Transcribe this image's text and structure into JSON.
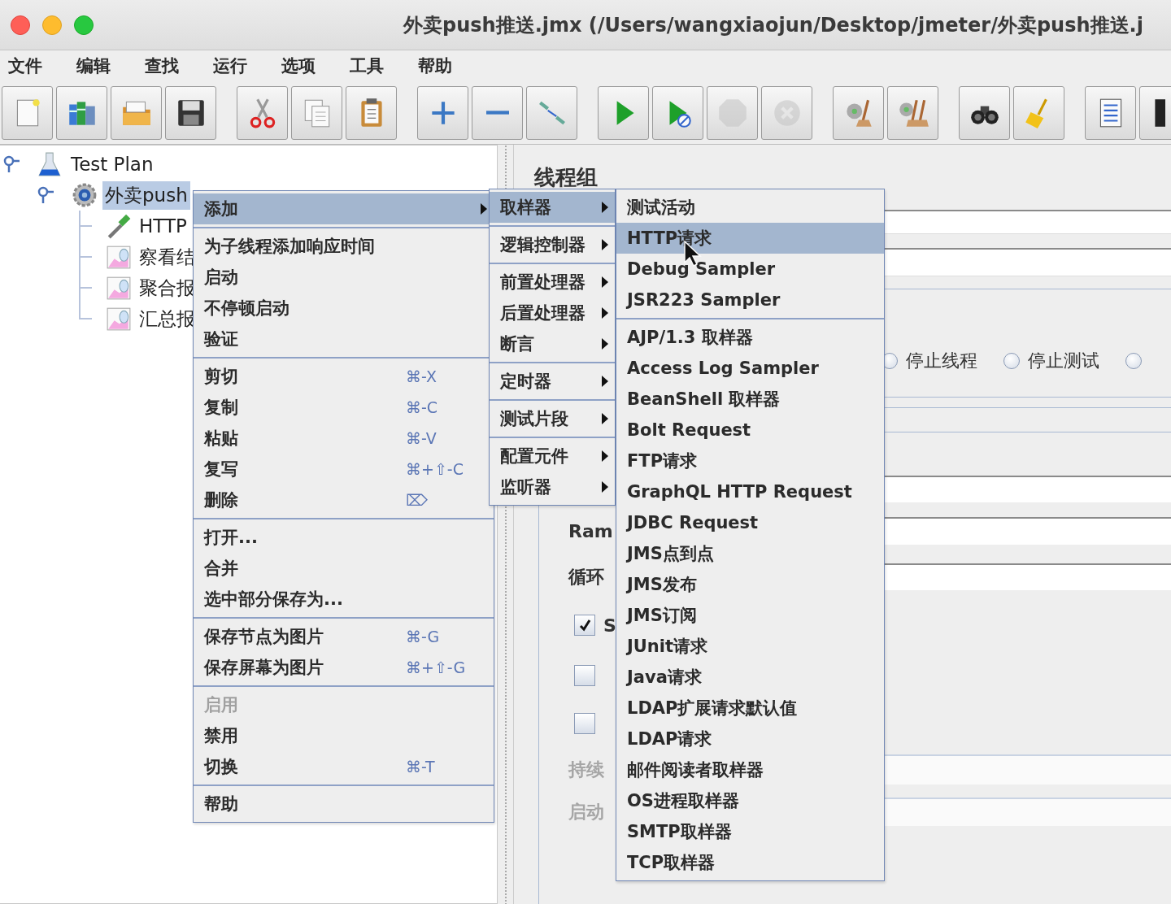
{
  "window": {
    "title": "外卖push推送.jmx (/Users/wangxiaojun/Desktop/jmeter/外卖push推送.j"
  },
  "menu_bar": [
    "文件",
    "编辑",
    "查找",
    "运行",
    "选项",
    "工具",
    "帮助"
  ],
  "toolbar": {
    "groups": [
      [
        {
          "kind": "new",
          "disabled": false
        },
        {
          "kind": "templates",
          "disabled": false
        },
        {
          "kind": "open",
          "disabled": false
        },
        {
          "kind": "save",
          "disabled": false
        }
      ],
      [
        {
          "kind": "cut",
          "disabled": false
        },
        {
          "kind": "copy",
          "disabled": false
        },
        {
          "kind": "paste",
          "disabled": false
        }
      ],
      [
        {
          "kind": "expand",
          "disabled": false
        },
        {
          "kind": "collapse",
          "disabled": false
        },
        {
          "kind": "toggle",
          "disabled": false
        }
      ],
      [
        {
          "kind": "start",
          "disabled": false
        },
        {
          "kind": "start_no_pauses",
          "disabled": false
        },
        {
          "kind": "stop",
          "disabled": true
        },
        {
          "kind": "shutdown",
          "disabled": true
        }
      ],
      [
        {
          "kind": "clear",
          "disabled": false
        },
        {
          "kind": "clear_all",
          "disabled": false
        }
      ],
      [
        {
          "kind": "search",
          "disabled": false
        },
        {
          "kind": "reset_search",
          "disabled": false
        }
      ],
      [
        {
          "kind": "function_helper",
          "disabled": false
        },
        {
          "kind": "help",
          "disabled": false
        }
      ]
    ]
  },
  "tree": [
    {
      "label": "Test Plan",
      "kind": "plan",
      "selected": false,
      "children": [
        {
          "label": "外卖push",
          "kind": "thread_group",
          "selected": true,
          "children": [
            {
              "label": "HTTP",
              "kind": "sampler",
              "selected": false
            },
            {
              "label": "察看结",
              "kind": "listener",
              "selected": false
            },
            {
              "label": "聚合报",
              "kind": "listener",
              "selected": false
            },
            {
              "label": "汇总报",
              "kind": "listener",
              "selected": false
            }
          ]
        }
      ]
    }
  ],
  "editor": {
    "title": "线程组",
    "top_fields": [
      {
        "kind": "field",
        "disabled": false
      },
      {
        "kind": "field",
        "disabled": false
      }
    ],
    "on_error_options": [
      {
        "label": "停止线程",
        "selected": false
      },
      {
        "label": "停止测试",
        "selected": false
      },
      {
        "selected": false
      }
    ],
    "thread_properties": [
      {
        "kind": "field",
        "disabled": false
      },
      {
        "kind": "field",
        "label": "Ram",
        "disabled": false
      },
      {
        "kind": "field",
        "label": "循环",
        "disabled": false
      },
      {
        "kind": "checkbox",
        "label": "S",
        "checked": true
      },
      {
        "kind": "checkbox",
        "checked": false
      },
      {
        "kind": "checkbox",
        "checked": false
      },
      {
        "kind": "field",
        "label": "持续",
        "disabled": true
      },
      {
        "kind": "field",
        "label": "启动",
        "disabled": true
      }
    ]
  },
  "context_menu": {
    "sections": [
      [
        {
          "label": "添加",
          "selected": true,
          "submenu": true,
          "disabled": false
        }
      ],
      [
        {
          "label": "为子线程添加响应时间",
          "selected": false,
          "submenu": false,
          "disabled": false
        },
        {
          "label": "启动",
          "selected": false,
          "submenu": false,
          "disabled": false
        },
        {
          "label": "不停顿启动",
          "selected": false,
          "submenu": false,
          "disabled": false
        },
        {
          "label": "验证",
          "selected": false,
          "submenu": false,
          "disabled": false
        }
      ],
      [
        {
          "label": "剪切",
          "shortcut": "⌘-X",
          "selected": false,
          "submenu": false,
          "disabled": false
        },
        {
          "label": "复制",
          "shortcut": "⌘-C",
          "selected": false,
          "submenu": false,
          "disabled": false
        },
        {
          "label": "粘贴",
          "shortcut": "⌘-V",
          "selected": false,
          "submenu": false,
          "disabled": false
        },
        {
          "label": "复写",
          "shortcut": "⌘+⇧-C",
          "selected": false,
          "submenu": false,
          "disabled": false
        },
        {
          "label": "删除",
          "shortcut": "⌦",
          "selected": false,
          "submenu": false,
          "disabled": false
        }
      ],
      [
        {
          "label": "打开...",
          "selected": false,
          "submenu": false,
          "disabled": false
        },
        {
          "label": "合并",
          "selected": false,
          "submenu": false,
          "disabled": false
        },
        {
          "label": "选中部分保存为...",
          "selected": false,
          "submenu": false,
          "disabled": false
        }
      ],
      [
        {
          "label": "保存节点为图片",
          "shortcut": "⌘-G",
          "selected": false,
          "submenu": false,
          "disabled": false
        },
        {
          "label": "保存屏幕为图片",
          "shortcut": "⌘+⇧-G",
          "selected": false,
          "submenu": false,
          "disabled": false
        }
      ],
      [
        {
          "label": "启用",
          "selected": false,
          "submenu": false,
          "disabled": true
        },
        {
          "label": "禁用",
          "selected": false,
          "submenu": false,
          "disabled": false
        },
        {
          "label": "切换",
          "shortcut": "⌘-T",
          "selected": false,
          "submenu": false,
          "disabled": false
        }
      ],
      [
        {
          "label": "帮助",
          "selected": false,
          "submenu": false,
          "disabled": false
        }
      ]
    ]
  },
  "add_menu": {
    "sections": [
      [
        {
          "label": "取样器",
          "selected": true,
          "submenu": true,
          "disabled": false
        }
      ],
      [
        {
          "label": "逻辑控制器",
          "selected": false,
          "submenu": true,
          "disabled": false
        }
      ],
      [
        {
          "label": "前置处理器",
          "selected": false,
          "submenu": true,
          "disabled": false
        },
        {
          "label": "后置处理器",
          "selected": false,
          "submenu": true,
          "disabled": false
        },
        {
          "label": "断言",
          "selected": false,
          "submenu": true,
          "disabled": false
        }
      ],
      [
        {
          "label": "定时器",
          "selected": false,
          "submenu": true,
          "disabled": false
        }
      ],
      [
        {
          "label": "测试片段",
          "selected": false,
          "submenu": true,
          "disabled": false
        }
      ],
      [
        {
          "label": "配置元件",
          "selected": false,
          "submenu": true,
          "disabled": false
        },
        {
          "label": "监听器",
          "selected": false,
          "submenu": true,
          "disabled": false
        }
      ]
    ]
  },
  "sampler_menu": {
    "sections": [
      [
        {
          "label": "测试活动",
          "selected": false,
          "submenu": false,
          "disabled": false
        },
        {
          "label": "HTTP请求",
          "selected": true,
          "submenu": false,
          "disabled": false
        },
        {
          "label": "Debug Sampler",
          "selected": false,
          "submenu": false,
          "disabled": false
        },
        {
          "label": "JSR223 Sampler",
          "selected": false,
          "submenu": false,
          "disabled": false
        }
      ],
      [
        {
          "label": "AJP/1.3 取样器",
          "selected": false,
          "submenu": false,
          "disabled": false
        },
        {
          "label": "Access Log Sampler",
          "selected": false,
          "submenu": false,
          "disabled": false
        },
        {
          "label": "BeanShell 取样器",
          "selected": false,
          "submenu": false,
          "disabled": false
        },
        {
          "label": "Bolt Request",
          "selected": false,
          "submenu": false,
          "disabled": false
        },
        {
          "label": "FTP请求",
          "selected": false,
          "submenu": false,
          "disabled": false
        },
        {
          "label": "GraphQL HTTP Request",
          "selected": false,
          "submenu": false,
          "disabled": false
        },
        {
          "label": "JDBC Request",
          "selected": false,
          "submenu": false,
          "disabled": false
        },
        {
          "label": "JMS点到点",
          "selected": false,
          "submenu": false,
          "disabled": false
        },
        {
          "label": "JMS发布",
          "selected": false,
          "submenu": false,
          "disabled": false
        },
        {
          "label": "JMS订阅",
          "selected": false,
          "submenu": false,
          "disabled": false
        },
        {
          "label": "JUnit请求",
          "selected": false,
          "submenu": false,
          "disabled": false
        },
        {
          "label": "Java请求",
          "selected": false,
          "submenu": false,
          "disabled": false
        },
        {
          "label": "LDAP扩展请求默认值",
          "selected": false,
          "submenu": false,
          "disabled": false
        },
        {
          "label": "LDAP请求",
          "selected": false,
          "submenu": false,
          "disabled": false
        },
        {
          "label": "邮件阅读者取样器",
          "selected": false,
          "submenu": false,
          "disabled": false
        },
        {
          "label": "OS进程取样器",
          "selected": false,
          "submenu": false,
          "disabled": false
        },
        {
          "label": "SMTP取样器",
          "selected": false,
          "submenu": false,
          "disabled": false
        },
        {
          "label": "TCP取样器",
          "selected": false,
          "submenu": false,
          "disabled": false
        }
      ]
    ]
  }
}
